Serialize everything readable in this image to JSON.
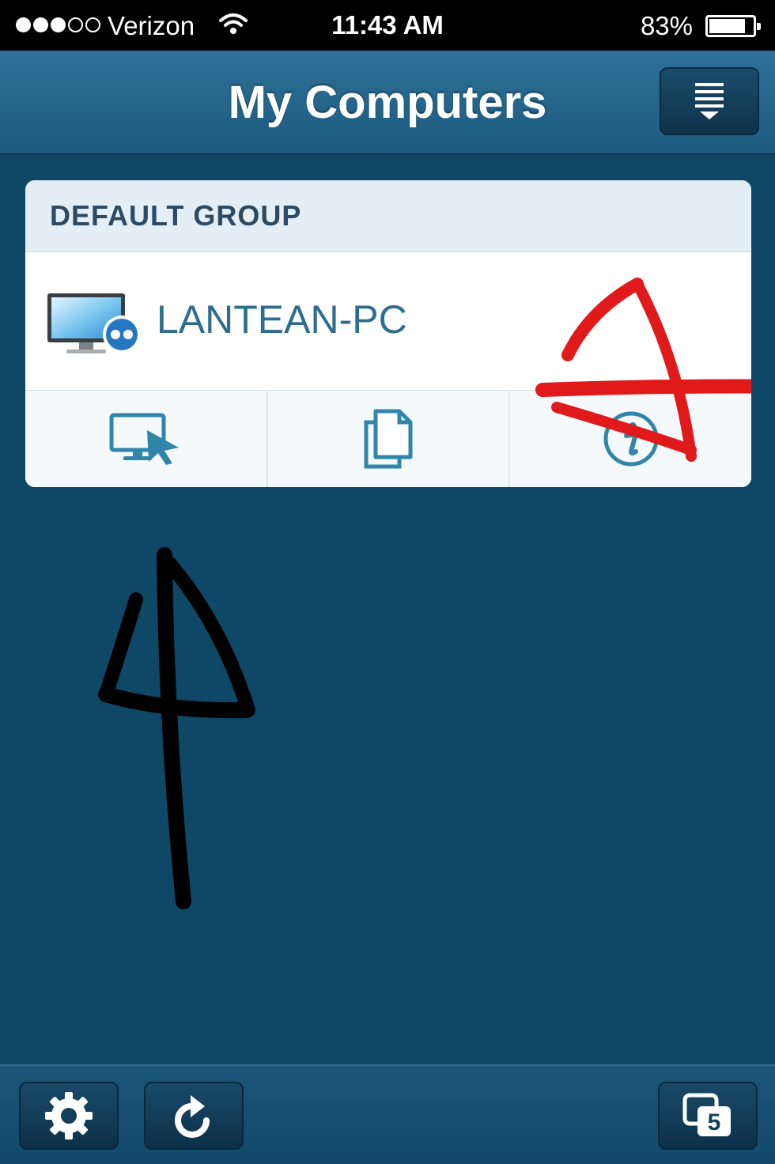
{
  "status_bar": {
    "carrier": "Verizon",
    "time": "11:43 AM",
    "battery_percent": "83%",
    "battery_level": 0.83,
    "signal_bars_filled": 3,
    "signal_bars_total": 5
  },
  "nav": {
    "title": "My Computers",
    "menu_icon": "list-menu-icon"
  },
  "groups": [
    {
      "title": "DEFAULT GROUP",
      "computers": [
        {
          "name": "LANTEAN-PC",
          "icon": "computer-online-icon",
          "actions": [
            {
              "name": "remote-control",
              "icon": "remote-control-icon"
            },
            {
              "name": "file-transfer",
              "icon": "file-transfer-icon"
            },
            {
              "name": "info",
              "icon": "info-icon"
            }
          ]
        }
      ]
    }
  ],
  "toolbar": {
    "settings_icon": "gear-icon",
    "refresh_icon": "refresh-icon",
    "sessions_icon": "sessions-icon",
    "sessions_count": "5"
  },
  "colors": {
    "background": "#0f4766",
    "navbar": "#2e7198",
    "card_header": "#e3eef7",
    "accent_blue": "#2f6d90",
    "annotation_red": "#e01a1a",
    "annotation_black": "#000000"
  }
}
